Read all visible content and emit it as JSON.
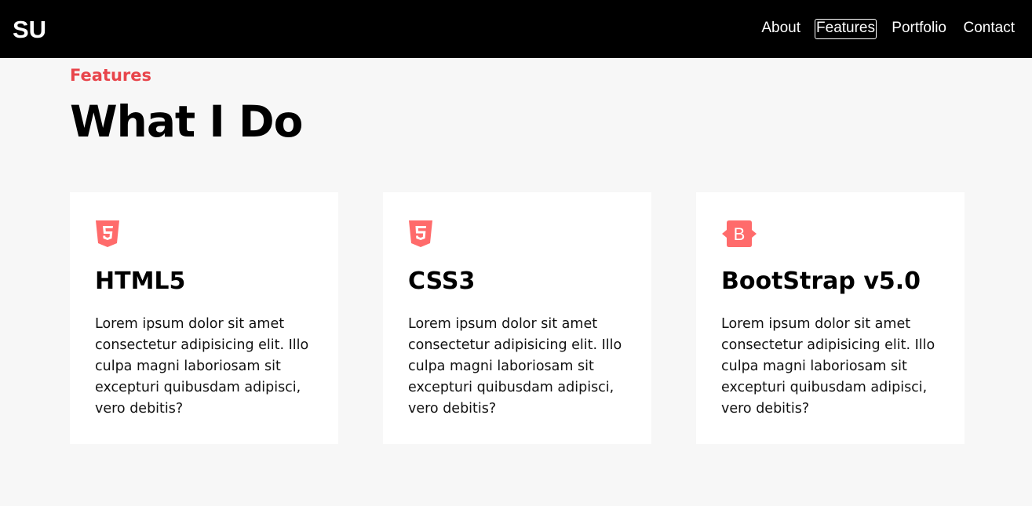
{
  "navbar": {
    "brand": "SU",
    "links": [
      {
        "label": "About",
        "active": false
      },
      {
        "label": "Features",
        "active": true
      },
      {
        "label": "Portfolio",
        "active": false
      },
      {
        "label": "Contact",
        "active": false
      }
    ]
  },
  "features": {
    "kicker": "Features",
    "title": "What I Do",
    "accent_color": "#e8454b",
    "cards": [
      {
        "icon": "html5-icon",
        "title": "HTML5",
        "text": "Lorem ipsum dolor sit amet consectetur adipisicing elit. Illo culpa magni laboriosam sit excepturi quibusdam adipisci, vero debitis?"
      },
      {
        "icon": "css3-icon",
        "title": "CSS3",
        "text": "Lorem ipsum dolor sit amet consectetur adipisicing elit. Illo culpa magni laboriosam sit excepturi quibusdam adipisci, vero debitis?"
      },
      {
        "icon": "bootstrap-icon",
        "title": "BootStrap v5.0",
        "text": "Lorem ipsum dolor sit amet consectetur adipisicing elit. Illo culpa magni laboriosam sit excepturi quibusdam adipisci, vero debitis?"
      }
    ]
  }
}
